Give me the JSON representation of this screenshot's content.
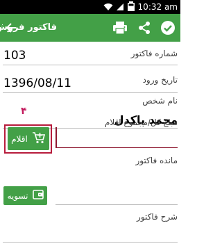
{
  "status_bar": {
    "time": "10:32 am"
  },
  "app_bar": {
    "title": "فاکتور فروش",
    "icons": [
      "check-icon",
      "share-icon",
      "print-icon",
      "back-arrow-icon"
    ]
  },
  "form": {
    "invoice_number": {
      "label": "شماره فاکتور",
      "value": "103"
    },
    "entry_date": {
      "label": "تاریخ ورود",
      "value": "1396/08/11"
    },
    "person_name": {
      "label": "نام شخص",
      "value": "محمد پاکدل"
    },
    "total_amount": {
      "label": "مبلغ کل/مجموع اقلام",
      "value": ""
    },
    "items_button": {
      "label": "اقلام"
    },
    "invoice_balance": {
      "label": "مانده فاکتور",
      "value": ""
    },
    "settle_button": {
      "label": "تسویه"
    },
    "description": {
      "label": "شرح فاکتور",
      "value": ""
    }
  },
  "annotation": {
    "number": "۴"
  },
  "colors": {
    "primary": "#43a047",
    "annotation": "#b71c3c"
  }
}
